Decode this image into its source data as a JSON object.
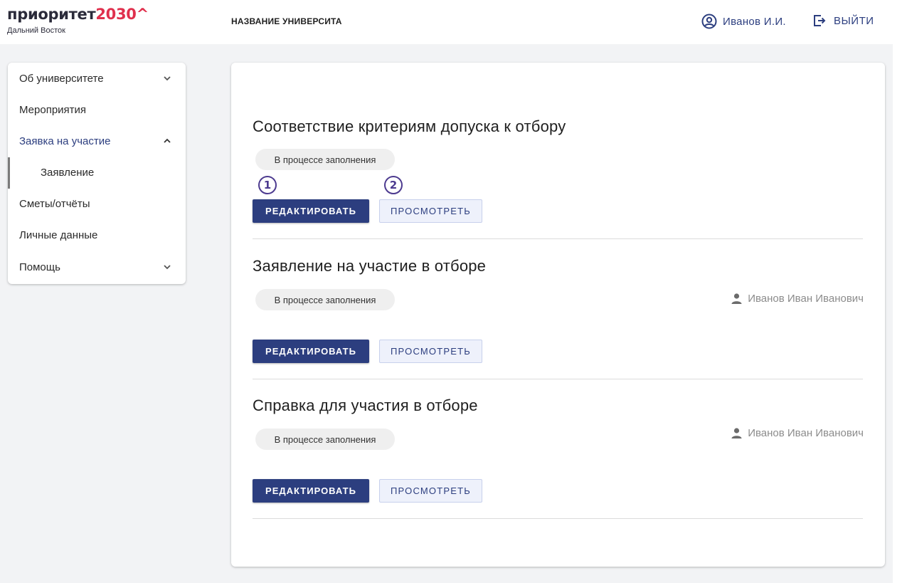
{
  "header": {
    "logo_word": "приоритет",
    "logo_year": "2030^",
    "logo_sub": "Дальний Восток",
    "university": "НАЗВАНИЕ УНИВЕРСИТА",
    "user_name": "Иванов И.И.",
    "logout_label": "ВЫЙТИ"
  },
  "sidebar": {
    "items": [
      {
        "label": "Об университете",
        "icon": "chevron-down-icon"
      },
      {
        "label": "Мероприятия"
      },
      {
        "label": "Заявка на участие",
        "icon": "chevron-up-icon"
      },
      {
        "label": "Заявление"
      },
      {
        "label": "Сметы/отчёты"
      },
      {
        "label": "Личные данные"
      },
      {
        "label": "Помощь",
        "icon": "chevron-down-icon"
      }
    ]
  },
  "sections": [
    {
      "title": "Соответствие критериям допуска к отбору",
      "status": "В процессе заполнения",
      "edit_label": "РЕДАКТИРОВАТЬ",
      "view_label": "ПРОСМОТРЕТЬ",
      "annotations": [
        "1",
        "2"
      ]
    },
    {
      "title": "Заявление на участие в отборе",
      "status": "В процессе заполнения",
      "owner": "Иванов Иван Иванович",
      "edit_label": "РЕДАКТИРОВАТЬ",
      "view_label": "ПРОСМОТРЕТЬ"
    },
    {
      "title": "Справка для участия в отборе",
      "status": "В процессе заполнения",
      "owner": "Иванов Иван Иванович",
      "edit_label": "РЕДАКТИРОВАТЬ",
      "view_label": "ПРОСМОТРЕТЬ"
    }
  ],
  "colors": {
    "primary": "#2c3e7f",
    "accent_red": "#e0304d",
    "annotation": "#4c3a8f"
  }
}
